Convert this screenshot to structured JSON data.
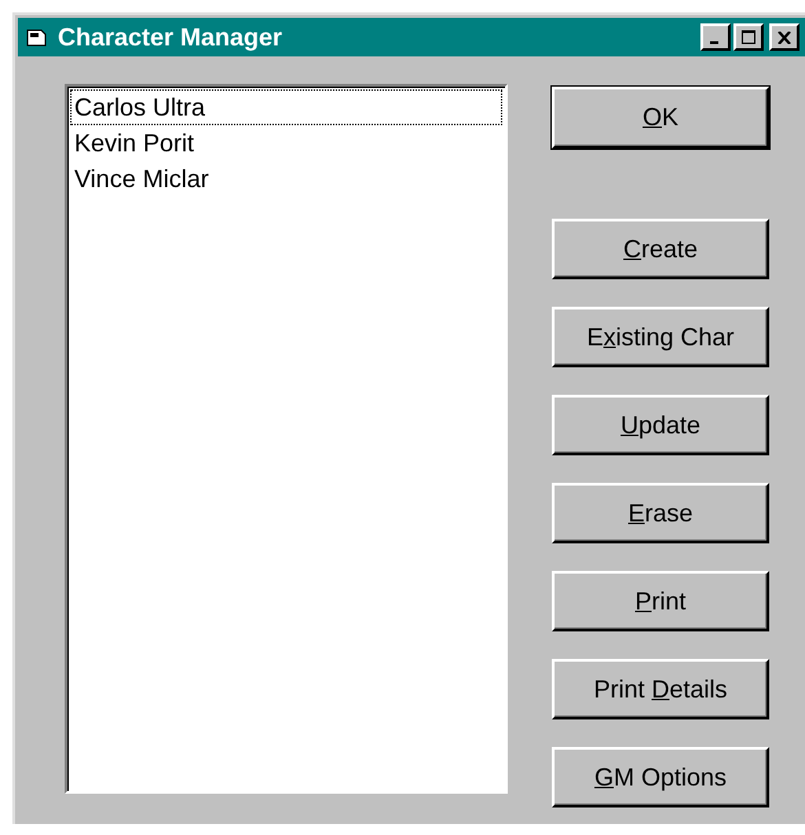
{
  "window": {
    "title": "Character Manager"
  },
  "list": {
    "items": [
      {
        "name": "Carlos Ultra",
        "selected": true
      },
      {
        "name": "Kevin Porit",
        "selected": false
      },
      {
        "name": "Vince Miclar",
        "selected": false
      }
    ]
  },
  "buttons": [
    {
      "accel": "O",
      "post": "K",
      "default": true
    },
    {
      "accel": "C",
      "post": "reate",
      "default": false
    },
    {
      "pre": "E",
      "accel": "x",
      "post": "isting Char",
      "default": false
    },
    {
      "accel": "U",
      "post": "pdate",
      "default": false
    },
    {
      "accel": "E",
      "post": "rase",
      "default": false
    },
    {
      "accel": "P",
      "post": "rint",
      "default": false
    },
    {
      "pre": "Print ",
      "accel": "D",
      "post": "etails",
      "default": false
    },
    {
      "accel": "G",
      "post": "M Options",
      "default": false
    }
  ]
}
